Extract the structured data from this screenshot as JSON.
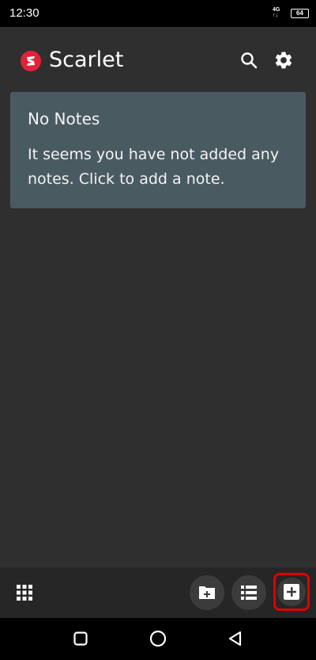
{
  "status_bar": {
    "time": "12:30",
    "network_line1": "4G",
    "network_line2": "↑↓",
    "battery": "64"
  },
  "app_bar": {
    "title": "Scarlet",
    "logo_icon": "scarlet-logo-icon",
    "search_icon": "search-icon",
    "settings_icon": "gear-icon",
    "brand_color": "#e0233a"
  },
  "empty_state": {
    "title": "No Notes",
    "message": "It seems you have not added any notes. Click to add a note.",
    "card_color": "#4a5a61"
  },
  "bottom_bar": {
    "grid_icon": "apps-grid-icon",
    "new_folder_icon": "new-folder-icon",
    "list_icon": "list-view-icon",
    "add_note_icon": "add-note-icon",
    "highlight_color": "#e00000"
  },
  "nav_bar": {
    "recents_icon": "square-icon",
    "home_icon": "circle-icon",
    "back_icon": "triangle-back-icon"
  }
}
